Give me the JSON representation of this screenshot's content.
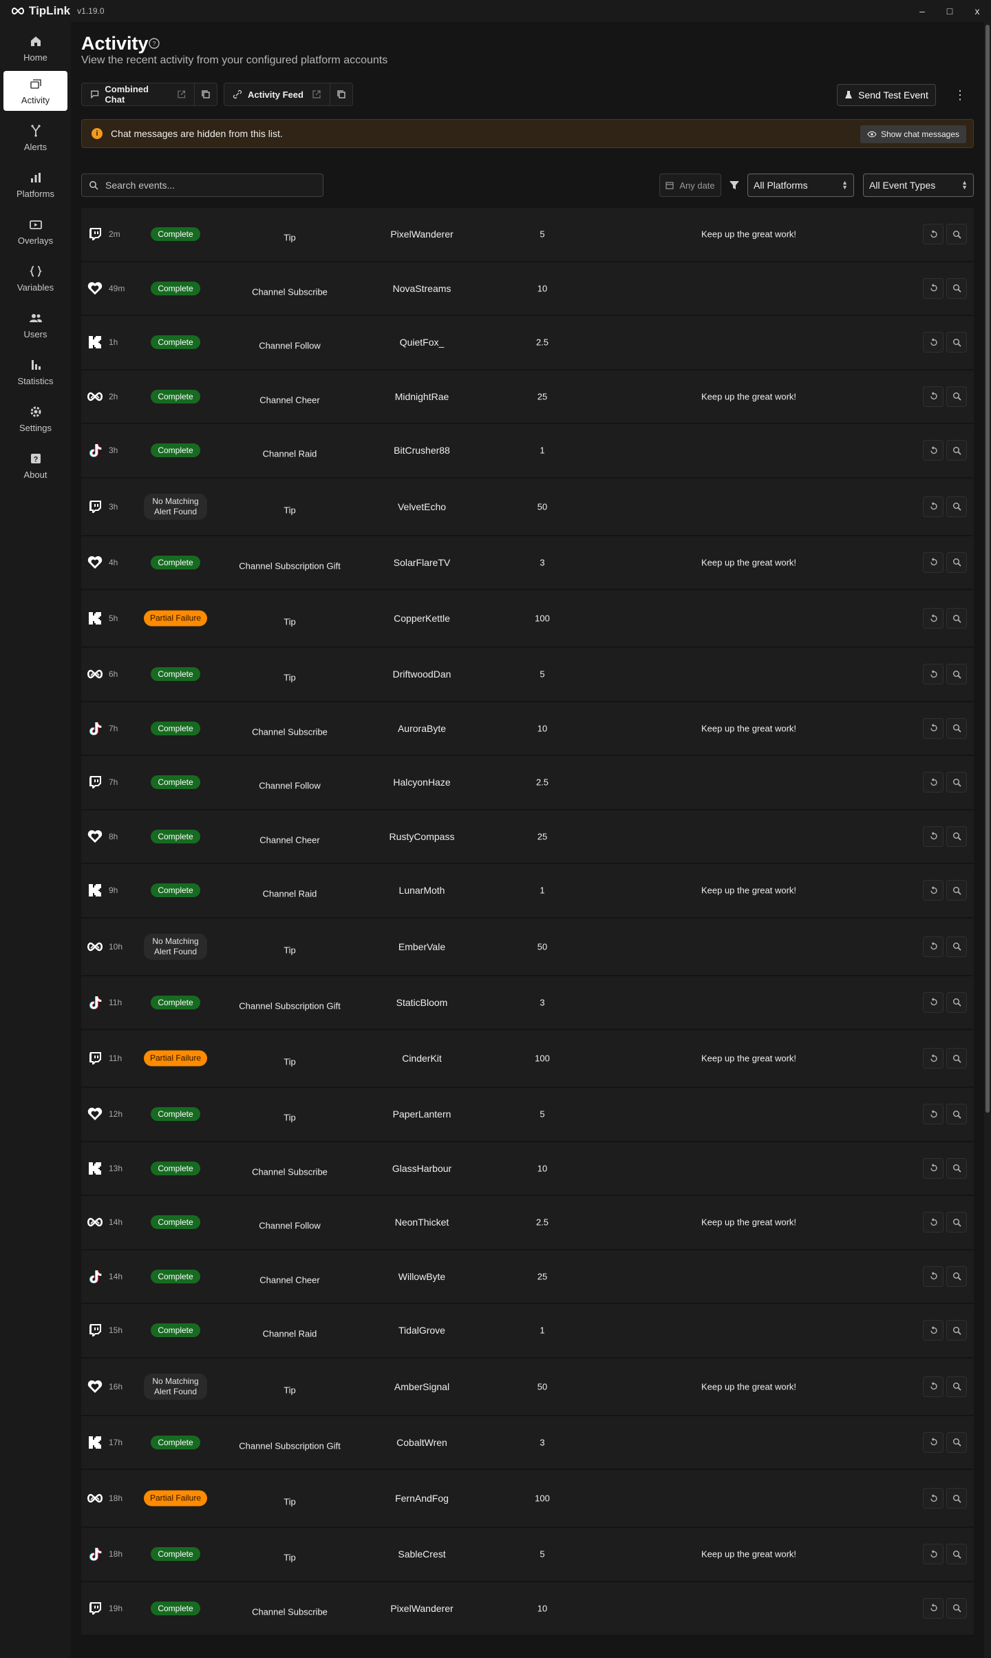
{
  "app": {
    "name": "TipLink",
    "version": "v1.19.0"
  },
  "window_controls": {
    "minimize": "–",
    "maximize": "□",
    "close": "x"
  },
  "nav": [
    {
      "label": "Home",
      "icon": "home-icon"
    },
    {
      "label": "Activity",
      "icon": "activity-icon",
      "active": true
    },
    {
      "label": "Alerts",
      "icon": "alerts-icon"
    },
    {
      "label": "Platforms",
      "icon": "bar-chart-icon"
    },
    {
      "label": "Overlays",
      "icon": "tv-icon"
    },
    {
      "label": "Variables",
      "icon": "braces-icon"
    },
    {
      "label": "Users",
      "icon": "users-icon"
    },
    {
      "label": "Statistics",
      "icon": "stats-icon"
    },
    {
      "label": "Settings",
      "icon": "gear-icon"
    },
    {
      "label": "About",
      "icon": "question-icon"
    }
  ],
  "page": {
    "title": "Activity",
    "subtitle": "View the recent activity from your configured platform accounts"
  },
  "toolbar": {
    "combined_chat": "Combined Chat",
    "activity_feed": "Activity Feed",
    "send_test_event": "Send Test Event",
    "more": "⋮"
  },
  "banner": {
    "text": "Chat messages are hidden from this list.",
    "button": "Show chat messages",
    "color": "#f29a1f"
  },
  "filters": {
    "search_placeholder": "Search events...",
    "date": "Any date",
    "platforms": "All Platforms",
    "event_types": "All Event Types"
  },
  "status_colors": {
    "complete": "#176b21",
    "partial": "#ff8b00",
    "nomatch": "#2a2a2a"
  },
  "events": [
    {
      "platform": "twitch",
      "time": "2m",
      "status": "Complete",
      "type": "Tip",
      "user": "PixelWanderer",
      "amount": "5",
      "message": "Keep up the great work!"
    },
    {
      "platform": "heart",
      "time": "49m",
      "status": "Complete",
      "type": "Channel Subscribe",
      "user": "NovaStreams",
      "amount": "10",
      "message": ""
    },
    {
      "platform": "kick",
      "time": "1h",
      "status": "Complete",
      "type": "Channel Follow",
      "user": "QuietFox_",
      "amount": "2.5",
      "message": ""
    },
    {
      "platform": "infinity",
      "time": "2h",
      "status": "Complete",
      "type": "Channel Cheer",
      "user": "MidnightRae",
      "amount": "25",
      "message": "Keep up the great work!"
    },
    {
      "platform": "tiktok",
      "time": "3h",
      "status": "Complete",
      "type": "Channel Raid",
      "user": "BitCrusher88",
      "amount": "1",
      "message": ""
    },
    {
      "platform": "twitch",
      "time": "3h",
      "status": "No Matching Alert Found",
      "type": "Tip",
      "user": "VelvetEcho",
      "amount": "50",
      "message": ""
    },
    {
      "platform": "heart",
      "time": "4h",
      "status": "Complete",
      "type": "Channel Subscription Gift",
      "user": "SolarFlareTV",
      "amount": "3",
      "message": "Keep up the great work!"
    },
    {
      "platform": "kick",
      "time": "5h",
      "status": "Partial Failure",
      "type": "Tip",
      "user": "CopperKettle",
      "amount": "100",
      "message": ""
    },
    {
      "platform": "infinity",
      "time": "6h",
      "status": "Complete",
      "type": "Tip",
      "user": "DriftwoodDan",
      "amount": "5",
      "message": ""
    },
    {
      "platform": "tiktok",
      "time": "7h",
      "status": "Complete",
      "type": "Channel Subscribe",
      "user": "AuroraByte",
      "amount": "10",
      "message": "Keep up the great work!"
    },
    {
      "platform": "twitch",
      "time": "7h",
      "status": "Complete",
      "type": "Channel Follow",
      "user": "HalcyonHaze",
      "amount": "2.5",
      "message": ""
    },
    {
      "platform": "heart",
      "time": "8h",
      "status": "Complete",
      "type": "Channel Cheer",
      "user": "RustyCompass",
      "amount": "25",
      "message": ""
    },
    {
      "platform": "kick",
      "time": "9h",
      "status": "Complete",
      "type": "Channel Raid",
      "user": "LunarMoth",
      "amount": "1",
      "message": "Keep up the great work!"
    },
    {
      "platform": "infinity",
      "time": "10h",
      "status": "No Matching Alert Found",
      "type": "Tip",
      "user": "EmberVale",
      "amount": "50",
      "message": ""
    },
    {
      "platform": "tiktok",
      "time": "11h",
      "status": "Complete",
      "type": "Channel Subscription Gift",
      "user": "StaticBloom",
      "amount": "3",
      "message": ""
    },
    {
      "platform": "twitch",
      "time": "11h",
      "status": "Partial Failure",
      "type": "Tip",
      "user": "CinderKit",
      "amount": "100",
      "message": "Keep up the great work!"
    },
    {
      "platform": "heart",
      "time": "12h",
      "status": "Complete",
      "type": "Tip",
      "user": "PaperLantern",
      "amount": "5",
      "message": ""
    },
    {
      "platform": "kick",
      "time": "13h",
      "status": "Complete",
      "type": "Channel Subscribe",
      "user": "GlassHarbour",
      "amount": "10",
      "message": ""
    },
    {
      "platform": "infinity",
      "time": "14h",
      "status": "Complete",
      "type": "Channel Follow",
      "user": "NeonThicket",
      "amount": "2.5",
      "message": "Keep up the great work!"
    },
    {
      "platform": "tiktok",
      "time": "14h",
      "status": "Complete",
      "type": "Channel Cheer",
      "user": "WillowByte",
      "amount": "25",
      "message": ""
    },
    {
      "platform": "twitch",
      "time": "15h",
      "status": "Complete",
      "type": "Channel Raid",
      "user": "TidalGrove",
      "amount": "1",
      "message": ""
    },
    {
      "platform": "heart",
      "time": "16h",
      "status": "No Matching Alert Found",
      "type": "Tip",
      "user": "AmberSignal",
      "amount": "50",
      "message": "Keep up the great work!"
    },
    {
      "platform": "kick",
      "time": "17h",
      "status": "Complete",
      "type": "Channel Subscription Gift",
      "user": "CobaltWren",
      "amount": "3",
      "message": ""
    },
    {
      "platform": "infinity",
      "time": "18h",
      "status": "Partial Failure",
      "type": "Tip",
      "user": "FernAndFog",
      "amount": "100",
      "message": ""
    },
    {
      "platform": "tiktok",
      "time": "18h",
      "status": "Complete",
      "type": "Tip",
      "user": "SableCrest",
      "amount": "5",
      "message": "Keep up the great work!"
    },
    {
      "platform": "twitch",
      "time": "19h",
      "status": "Complete",
      "type": "Channel Subscribe",
      "user": "PixelWanderer",
      "amount": "10",
      "message": ""
    }
  ]
}
